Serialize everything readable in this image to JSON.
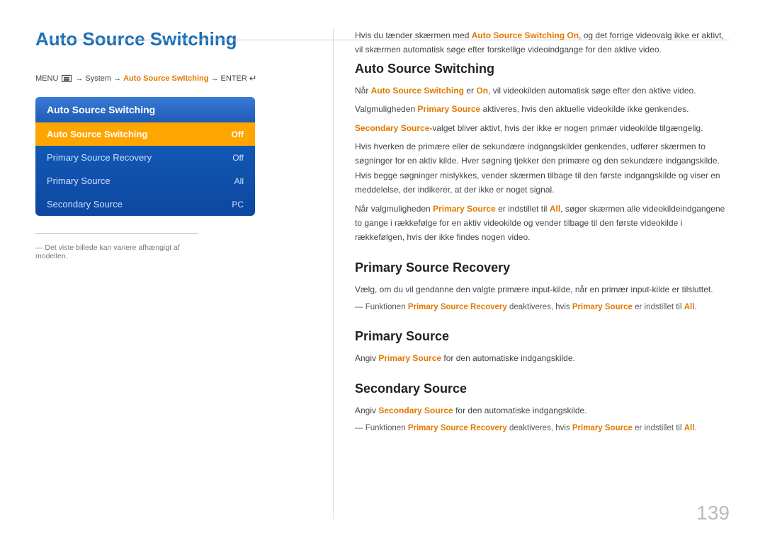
{
  "page": {
    "title": "Auto Source Switching",
    "page_number": "139"
  },
  "menu_path": {
    "menu_label": "MENU",
    "arrow": "→",
    "system": "System",
    "auto_source": "Auto Source Switching",
    "enter": "ENTER"
  },
  "menu_box": {
    "header": "Auto Source Switching",
    "items": [
      {
        "label": "Auto Source Switching",
        "value": "Off",
        "active": true
      },
      {
        "label": "Primary Source Recovery",
        "value": "Off",
        "active": false
      },
      {
        "label": "Primary Source",
        "value": "All",
        "active": false
      },
      {
        "label": "Secondary Source",
        "value": "PC",
        "active": false
      }
    ]
  },
  "footnote": "— Det viste billede kan variere afhængigt af modellen.",
  "right_column": {
    "intro_text": "Hvis du tænder skærmen med Auto Source Switching On, og det forrige videovalg ikke er aktivt, vil skærmen automatisk søge efter forskellige videoindgange for den aktive video.",
    "sections": [
      {
        "id": "auto-source-switching",
        "title": "Auto Source Switching",
        "paragraphs": [
          "Når Auto Source Switching er On, vil videokilden automatisk søge efter den aktive video.",
          "Valgmuligheden Primary Source aktiveres, hvis den aktuelle videokilde ikke genkendes.",
          "Secondary Source-valget bliver aktivt, hvis der ikke er nogen primær videokilde tilgængelig.",
          "Hvis hverken de primære eller de sekundære indgangskilder genkendes, udfører skærmen to søgninger for en aktiv kilde. Hver søgning tjekker den primære og den sekundære indgangskilde. Hvis begge søgninger mislykkes, vender skærmen tilbage til den første indgangskilde og viser en meddelelse, der indikerer, at der ikke er noget signal.",
          "Når valgmuligheden Primary Source er indstillet til All, søger skærmen alle videokildeindgangene to gange i rækkefølge for en aktiv videokilde og vender tilbage til den første videokilde i rækkefølgen, hvis der ikke findes nogen video."
        ]
      },
      {
        "id": "primary-source-recovery",
        "title": "Primary Source Recovery",
        "paragraphs": [
          "Vælg, om du vil gendanne den valgte primære input-kilde, når en primær input-kilde er tilsluttet."
        ],
        "notes": [
          "Funktionen Primary Source Recovery deaktiveres, hvis Primary Source er indstillet til All."
        ]
      },
      {
        "id": "primary-source",
        "title": "Primary Source",
        "paragraphs": [
          "Angiv Primary Source for den automatiske indgangskilde."
        ]
      },
      {
        "id": "secondary-source",
        "title": "Secondary Source",
        "paragraphs": [
          "Angiv Secondary Source for den automatiske indgangskilde."
        ],
        "notes": [
          "Funktionen Primary Source Recovery deaktiveres, hvis Primary Source er indstillet til All."
        ]
      }
    ]
  }
}
